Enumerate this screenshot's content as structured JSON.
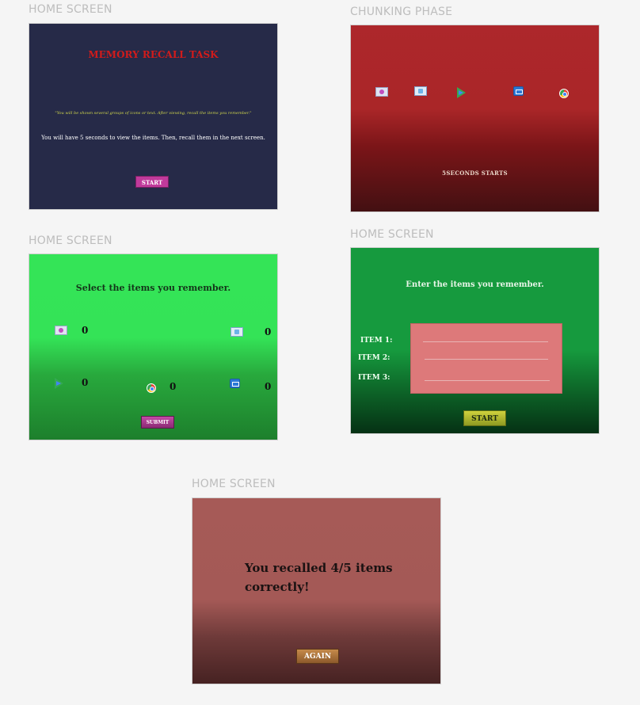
{
  "screen1": {
    "label": "HOME SCREEN",
    "title": "MEMORY RECALL TASK",
    "description": "\"You will be shown several groups of icons or text. After viewing, recall the items you remember.\"",
    "note": "You will have 5 seconds to view the items. Then, recall them in the next screen.",
    "start_button": "START"
  },
  "screen2": {
    "label": "CHUNKING PHASE",
    "icons": [
      "photo-app-icon",
      "contact-app-icon",
      "play-store-icon",
      "mail-icon",
      "chrome-icon"
    ],
    "timer_text": "5SECONDS   STARTS"
  },
  "screen3": {
    "label": "HOME SCREEN",
    "prompt": "Select the items you remember.",
    "counts": [
      "0",
      "0",
      "0",
      "0",
      "0"
    ],
    "submit_button": "SUBMIT"
  },
  "screen4": {
    "label": "HOME SCREEN",
    "prompt": "Enter the items you remember.",
    "fields": [
      "ITEM 1:",
      "ITEM 2:",
      "ITEM 3:"
    ],
    "start_button": "START"
  },
  "screen5": {
    "label": "HOME SCREEN",
    "result": "You recalled 4/5 items correctly!",
    "again_button": "AGAIN"
  },
  "colors": {
    "screen1_bg": "#262a48",
    "screen2_bg": "#ad272b",
    "screen3_bg": "#34e457",
    "screen4_bg": "#169a3e",
    "screen5_bg": "#a65a57"
  }
}
